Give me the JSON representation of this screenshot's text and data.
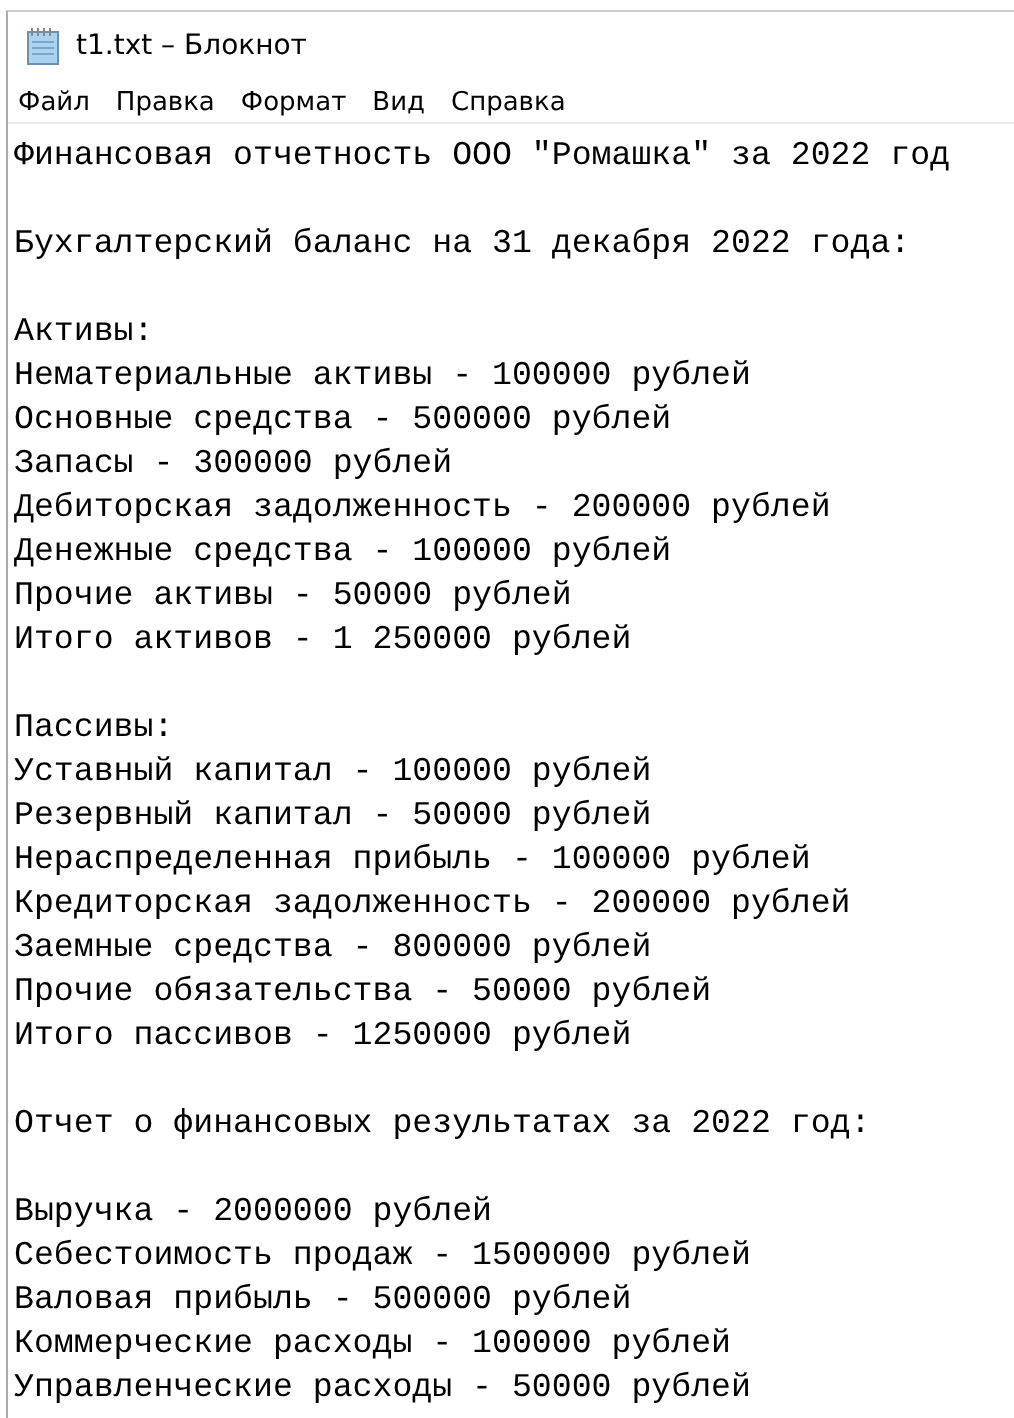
{
  "window": {
    "title": "t1.txt – Блокнот"
  },
  "menu": [
    "Файл",
    "Правка",
    "Формат",
    "Вид",
    "Справка"
  ],
  "document": {
    "paragraphs": [
      [
        "Финансовая отчетность ООО \"Ромашка\" за 2022 год"
      ],
      [
        "Бухгалтерский баланс на 31 декабря 2022 года:"
      ],
      [
        "Активы:",
        "Нематериальные активы - 100000 рублей",
        "Основные средства - 500000 рублей",
        "Запасы - 300000 рублей",
        "Дебиторская задолженность - 200000 рублей",
        "Денежные средства - 100000 рублей",
        "Прочие активы - 50000 рублей",
        "Итого активов - 1 250000 рублей"
      ],
      [
        "Пассивы:",
        "Уставный капитал - 100000 рублей",
        "Резервный капитал - 50000 рублей",
        "Нераспределенная прибыль - 100000 рублей",
        "Кредиторская задолженность - 200000 рублей",
        "Заемные средства - 800000 рублей",
        "Прочие обязательства - 50000 рублей",
        "Итого пассивов - 1250000 рублей"
      ],
      [
        "Отчет о финансовых результатах за 2022 год:"
      ],
      [
        "Выручка - 2000000 рублей",
        "Себестоимость продаж - 1500000 рублей",
        "Валовая прибыль - 500000 рублей",
        "Коммерческие расходы - 100000 рублей",
        "Управленческие расходы - 50000 рублей"
      ]
    ]
  }
}
